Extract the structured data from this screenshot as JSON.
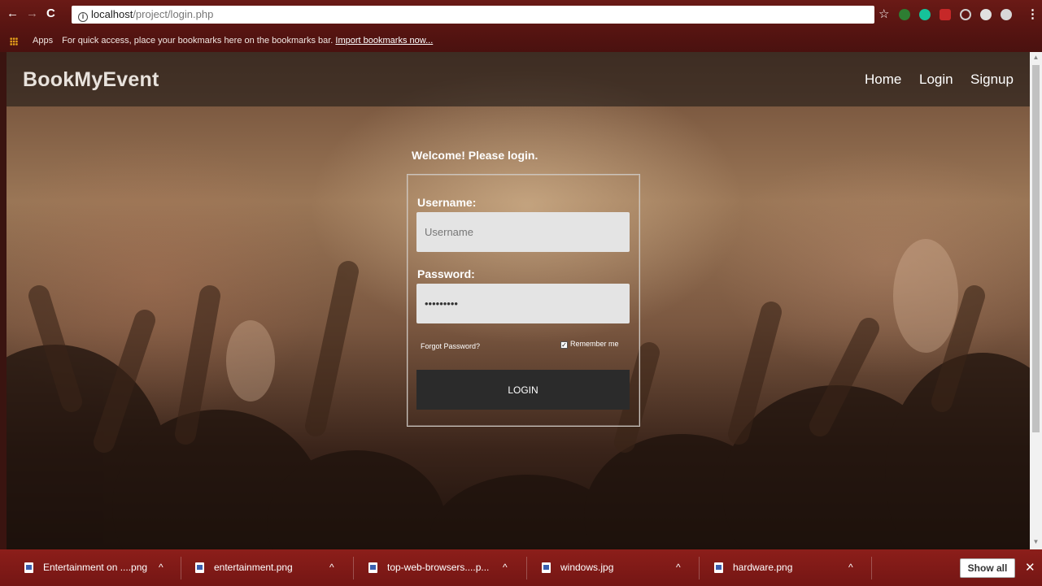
{
  "browser": {
    "url_host": "localhost",
    "url_path": "/project/login.php",
    "bookmarks_bar": {
      "apps_label": "Apps",
      "hint": "For quick access, place your bookmarks here on the bookmarks bar.",
      "import_link": "Import bookmarks now..."
    },
    "icons": [
      "back-icon",
      "forward-icon",
      "reload-icon",
      "info-icon",
      "star-icon",
      "menu-dots-icon"
    ],
    "extensions": [
      {
        "name": "s-extension-icon",
        "color": "#2e7d32"
      },
      {
        "name": "grammarly-icon",
        "color": "#15c39a"
      },
      {
        "name": "abp-icon",
        "color": "#c62828"
      },
      {
        "name": "c-extension-icon",
        "color": "#cfcfcf"
      },
      {
        "name": "circle-extension-icon",
        "color": "#e0e0e0"
      },
      {
        "name": "blob-extension-icon",
        "color": "#d8d8d8"
      }
    ]
  },
  "site": {
    "brand": "BookMyEvent",
    "nav": [
      {
        "label": "Home"
      },
      {
        "label": "Login"
      },
      {
        "label": "Signup"
      }
    ]
  },
  "login": {
    "welcome": "Welcome! Please login.",
    "username_label": "Username:",
    "username_placeholder": "Username",
    "password_label": "Password:",
    "password_value": "•••••••••",
    "forgot": "Forgot Password?",
    "remember": "Remember me",
    "remember_checked": true,
    "button": "LOGIN"
  },
  "downloads": {
    "items": [
      {
        "name": "Entertainment on ....png"
      },
      {
        "name": "entertainment.png"
      },
      {
        "name": "top-web-browsers....p..."
      },
      {
        "name": "windows.jpg"
      },
      {
        "name": "hardware.png"
      }
    ],
    "show_all": "Show all",
    "close": "✕"
  },
  "colors": {
    "chrome_red": "#6a1a16",
    "shelf_red": "#8c1e1a",
    "login_button": "#2b2b2b"
  }
}
